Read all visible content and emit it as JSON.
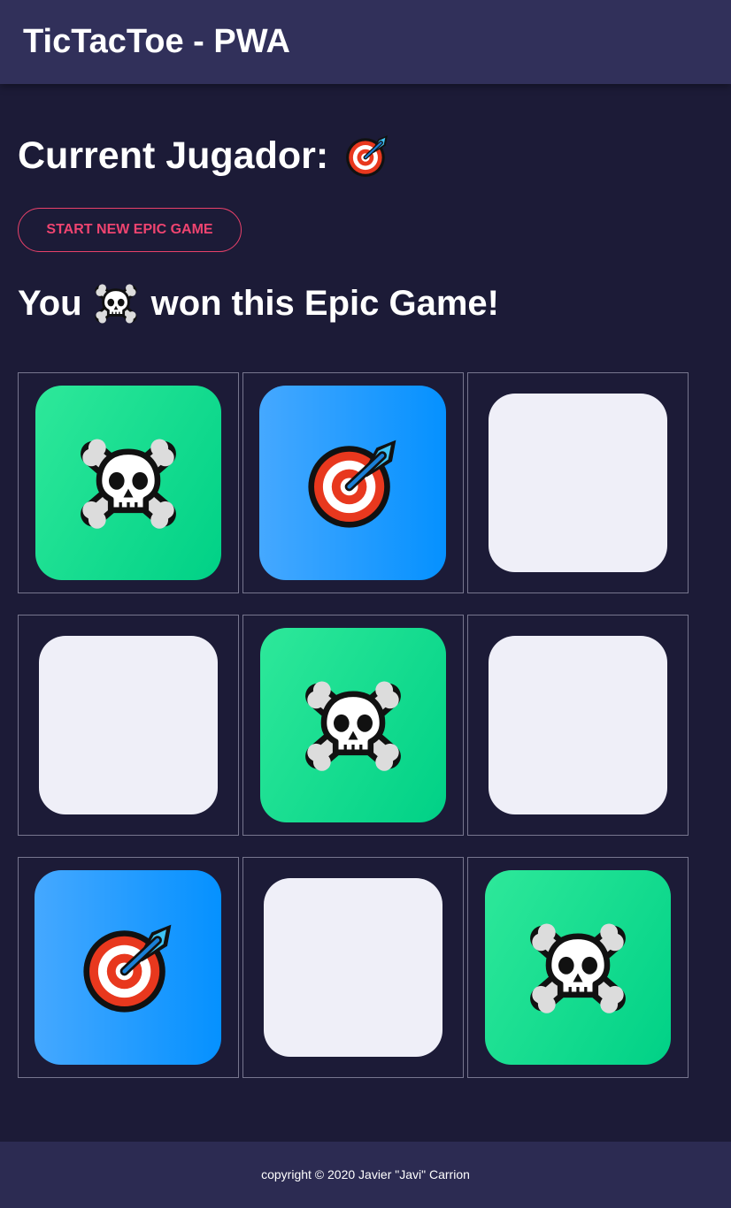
{
  "header": {
    "title": "TicTacToe - PWA"
  },
  "status": {
    "current_player_label": "Current Jugador:",
    "current_player_icon": "target-icon"
  },
  "controls": {
    "new_game_label": "START NEW EPIC GAME"
  },
  "result": {
    "prefix": "You",
    "winner_icon": "skull-crossbones-icon",
    "suffix": "won this Epic Game!"
  },
  "board": {
    "cells": [
      "skull",
      "target",
      "empty",
      "empty",
      "skull",
      "empty",
      "target",
      "empty",
      "skull"
    ]
  },
  "colors": {
    "background": "#1c1b37",
    "header": "#31305a",
    "footer": "#2c2b52",
    "accent": "#ef4470",
    "skull_tile": "#00d186",
    "target_tile": "#0591ff",
    "empty_tile": "#efeff8"
  },
  "footer": {
    "copyright": "copyright © 2020 Javier \"Javi\" Carrion"
  }
}
